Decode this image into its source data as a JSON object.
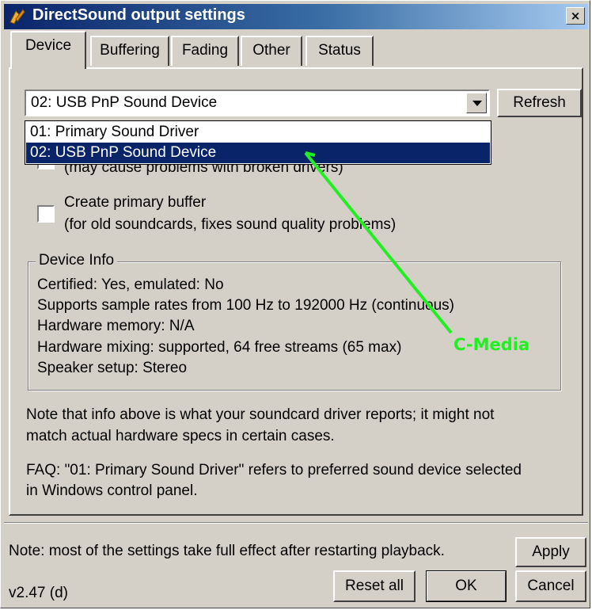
{
  "window": {
    "title": "DirectSound output settings",
    "close_label": "×"
  },
  "tabs": [
    {
      "label": "Device",
      "active": true
    },
    {
      "label": "Buffering"
    },
    {
      "label": "Fading"
    },
    {
      "label": "Other"
    },
    {
      "label": "Status"
    }
  ],
  "device": {
    "selected": "02: USB PnP Sound Device",
    "refresh_label": "Refresh",
    "options": [
      {
        "label": "01: Primary Sound Driver",
        "selected": false
      },
      {
        "label": "02: USB PnP Sound Device",
        "selected": true
      }
    ],
    "hidden_option_text": "(may cause problems with broken drivers)",
    "primary_buffer": {
      "checked": false,
      "label": "Create primary buffer",
      "sublabel": "(for old soundcards, fixes sound quality problems)"
    }
  },
  "device_info": {
    "title": "Device Info",
    "lines": [
      "Certified: Yes, emulated: No",
      "Supports sample rates from 100 Hz to 192000 Hz (continuous)",
      "Hardware memory: N/A",
      "Hardware mixing: supported, 64 free streams (65 max)",
      "Speaker setup: Stereo"
    ]
  },
  "annotation": {
    "label": "C-Media",
    "color": "#22ee22"
  },
  "notes": {
    "note1_line1": "Note that info above is what your soundcard driver reports; it might not",
    "note1_line2": "match actual hardware specs in certain cases.",
    "faq_line1": "FAQ: \"01: Primary Sound Driver\" refers to preferred sound device selected",
    "faq_line2": "in Windows control panel."
  },
  "footer": {
    "note": "Note: most of the settings take full effect after restarting playback.",
    "apply_label": "Apply",
    "reset_label": "Reset all",
    "ok_label": "OK",
    "cancel_label": "Cancel",
    "version": "v2.47 (d)"
  },
  "colors": {
    "title_gradient_start": "#0a246a",
    "title_gradient_end": "#a6caf0",
    "selection": "#0a246a",
    "face": "#d4d0c8"
  }
}
